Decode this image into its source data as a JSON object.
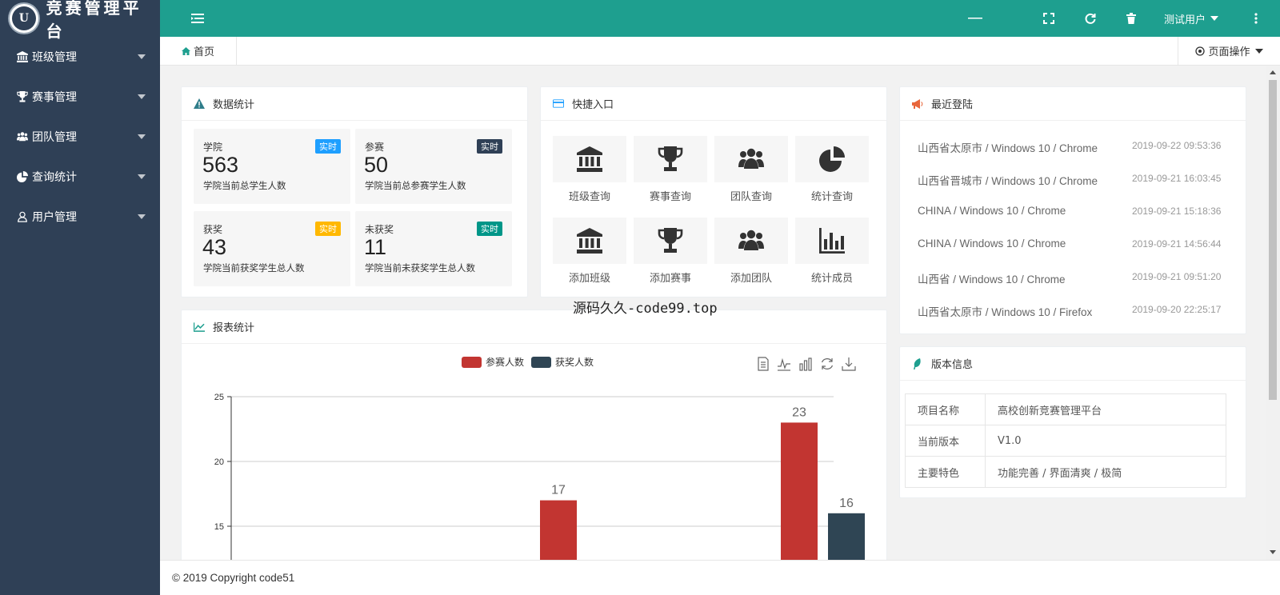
{
  "app": {
    "title": "竞赛管理平台",
    "logo_letter": "U"
  },
  "sidebar": {
    "items": [
      {
        "label": "班级管理",
        "icon": "bank-icon"
      },
      {
        "label": "赛事管理",
        "icon": "trophy-icon"
      },
      {
        "label": "团队管理",
        "icon": "users-icon"
      },
      {
        "label": "查询统计",
        "icon": "pie-chart-icon"
      },
      {
        "label": "用户管理",
        "icon": "user-icon"
      }
    ]
  },
  "header": {
    "user": "测试用户",
    "icons": [
      "menu-toggle-icon",
      "minus-icon",
      "fullscreen-icon",
      "refresh-icon",
      "trash-icon",
      "more-vertical-icon"
    ],
    "color": "#1e9f8f"
  },
  "tabs": {
    "home": "首页",
    "page_ops": "页面操作"
  },
  "stats": {
    "title": "数据统计",
    "cards": [
      {
        "label": "学院",
        "badge": "实时",
        "badge_color": "#1e9fff",
        "value": "563",
        "desc": "学院当前总学生人数"
      },
      {
        "label": "参赛",
        "badge": "实时",
        "badge_color": "#2f4056",
        "value": "50",
        "desc": "学院当前总参赛学生人数"
      },
      {
        "label": "获奖",
        "badge": "实时",
        "badge_color": "#ffb800",
        "value": "43",
        "desc": "学院当前获奖学生总人数"
      },
      {
        "label": "未获奖",
        "badge": "实时",
        "badge_color": "#009688",
        "value": "11",
        "desc": "学院当前未获奖学生总人数"
      }
    ]
  },
  "quick": {
    "title": "快捷入口",
    "items": [
      {
        "label": "班级查询",
        "icon": "bank-icon"
      },
      {
        "label": "赛事查询",
        "icon": "trophy-icon"
      },
      {
        "label": "团队查询",
        "icon": "users-icon"
      },
      {
        "label": "统计查询",
        "icon": "pie-chart-icon"
      },
      {
        "label": "添加班级",
        "icon": "bank-icon"
      },
      {
        "label": "添加赛事",
        "icon": "trophy-icon"
      },
      {
        "label": "添加团队",
        "icon": "users-icon"
      },
      {
        "label": "统计成员",
        "icon": "bar-chart-icon"
      }
    ]
  },
  "logins": {
    "title": "最近登陆",
    "rows": [
      {
        "loc": "山西省太原市 / Windows 10 / Chrome",
        "time": "2019-09-22 09:53:36"
      },
      {
        "loc": "山西省晋城市 / Windows 10 / Chrome",
        "time": "2019-09-21 16:03:45"
      },
      {
        "loc": "CHINA / Windows 10 / Chrome",
        "time": "2019-09-21 15:18:36"
      },
      {
        "loc": "CHINA / Windows 10 / Chrome",
        "time": "2019-09-21 14:56:44"
      },
      {
        "loc": "山西省 / Windows 10 / Chrome",
        "time": "2019-09-21 09:51:20"
      },
      {
        "loc": "山西省太原市 / Windows 10 / Firefox",
        "time": "2019-09-20 22:25:17"
      }
    ]
  },
  "version": {
    "title": "版本信息",
    "rows": [
      {
        "k": "项目名称",
        "v": "高校创新竞赛管理平台"
      },
      {
        "k": "当前版本",
        "v": "V1.0"
      },
      {
        "k": "主要特色",
        "v": "功能完善 / 界面清爽 / 极简"
      }
    ]
  },
  "report": {
    "title": "报表统计",
    "tool_icons": [
      "data-view-icon",
      "line-chart-icon",
      "bar-chart-icon",
      "restore-icon",
      "download-icon"
    ]
  },
  "chart_data": {
    "type": "bar",
    "yticks": [
      15,
      20,
      25
    ],
    "ylim_visible": [
      12.5,
      25
    ],
    "series": [
      {
        "name": "参赛人数",
        "color": "#c23531"
      },
      {
        "name": "获奖人数",
        "color": "#2f4554"
      }
    ],
    "visible_bars": [
      {
        "series": 0,
        "group": 1,
        "value": 17
      },
      {
        "series": 0,
        "group": 2,
        "value": 23
      },
      {
        "series": 1,
        "group": 2,
        "value": 16
      }
    ]
  },
  "watermark": "源码久久-code99.top",
  "footer": "© 2019 Copyright code51"
}
